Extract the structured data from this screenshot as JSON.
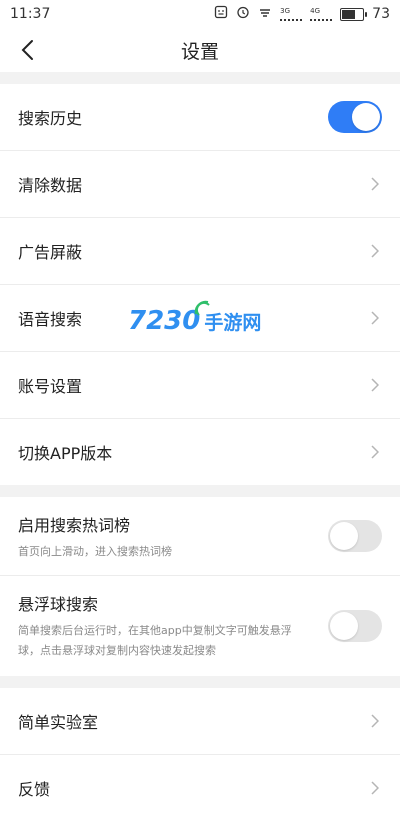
{
  "status_bar": {
    "time": "11:37",
    "net1_label": "3G",
    "net2_label": "4G",
    "battery": "73",
    "battery_level": 0.73
  },
  "header": {
    "title": "设置"
  },
  "group1": [
    {
      "label": "搜索历史",
      "control": "toggle",
      "on": true
    },
    {
      "label": "清除数据",
      "control": "chevron"
    },
    {
      "label": "广告屏蔽",
      "control": "chevron"
    },
    {
      "label": "语音搜索",
      "control": "chevron"
    },
    {
      "label": "账号设置",
      "control": "chevron"
    },
    {
      "label": "切换APP版本",
      "control": "chevron"
    }
  ],
  "group2": [
    {
      "label": "启用搜索热词榜",
      "sub": "首页向上滑动，进入搜索热词榜",
      "on": false
    },
    {
      "label": "悬浮球搜索",
      "sub": "简单搜索后台运行时，在其他app中复制文字可触发悬浮球，点击悬浮球对复制内容快速发起搜索",
      "on": false
    }
  ],
  "group3": [
    {
      "label": "简单实验室"
    },
    {
      "label": "反馈"
    }
  ],
  "watermark": {
    "number": "7230",
    "text": "手游网"
  },
  "colors": {
    "accent": "#2f7df6",
    "divider": "#f2f2f2"
  }
}
